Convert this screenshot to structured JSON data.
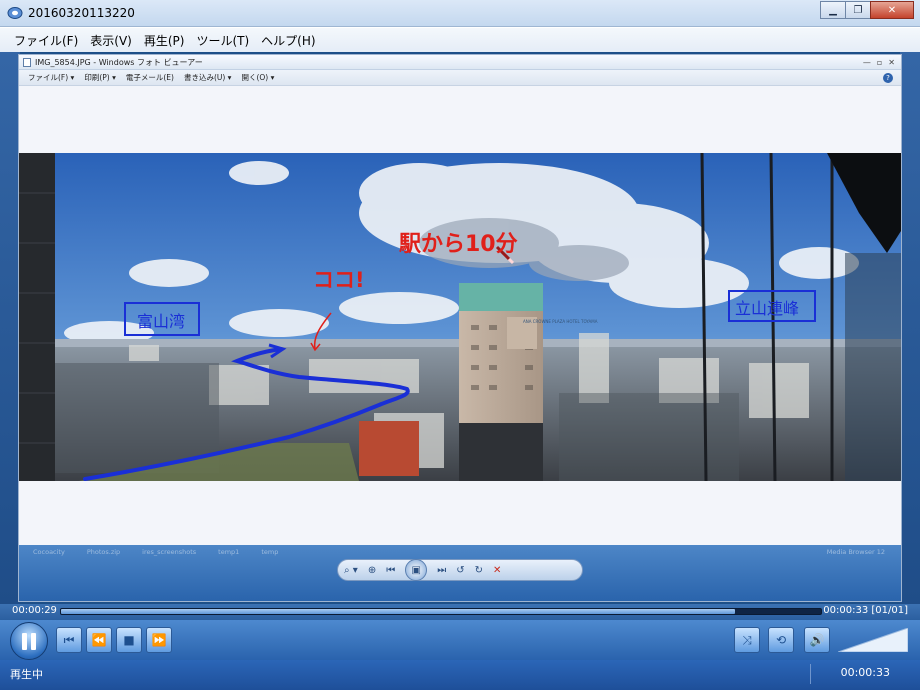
{
  "window": {
    "title": "20160320113220",
    "minimize_glyph": "▁",
    "maximize_glyph": "❐",
    "close_glyph": "✕"
  },
  "menu": [
    "ファイル(F)",
    "表示(V)",
    "再生(P)",
    "ツール(T)",
    "ヘルプ(H)"
  ],
  "photo_viewer": {
    "title": "IMG_5854.JPG - Windows フォト ビューアー",
    "menu": [
      "ファイル(F)  ▾",
      "印刷(P)  ▾",
      "電子メール(E)",
      "書き込み(U)  ▾",
      "開く(O)  ▾"
    ],
    "help": "?",
    "window_glyphs": [
      "—",
      "▫",
      "✕"
    ],
    "taskbar_ghost": [
      "Cocoacity",
      "Photos.zip",
      "ires_screenshots",
      "temp1",
      "temp",
      "Media Browser 12"
    ],
    "controls": {
      "zoom": "⌕ ▾",
      "actual_size": "⊕",
      "prev": "⏮",
      "slideshow": "▣",
      "next": "⏭",
      "rotate_ccw": "↺",
      "rotate_cw": "↻",
      "delete": "✕"
    },
    "annotations": {
      "station": "駅から10分",
      "here": "ココ!",
      "bay": "富山湾",
      "mountain": "立山連峰"
    },
    "building_sign": "ANA CROWNE PLAZA HOTEL TOYAMA"
  },
  "player": {
    "time_elapsed": "00:00:29",
    "time_total": "00:00:33  [01/01]",
    "progress": 0.887,
    "status": "再生中",
    "status_time": "00:00:33",
    "buttons": {
      "prev": "⏮",
      "rewind": "⏪",
      "stop": "■",
      "forward": "⏩",
      "shuffle": "⤨",
      "repeat": "⟲",
      "volume": "🔊"
    }
  },
  "colors": {
    "annotation_red": "#e0201a",
    "annotation_blue": "#1a2fd6",
    "player_blue": "#2a63ad"
  }
}
